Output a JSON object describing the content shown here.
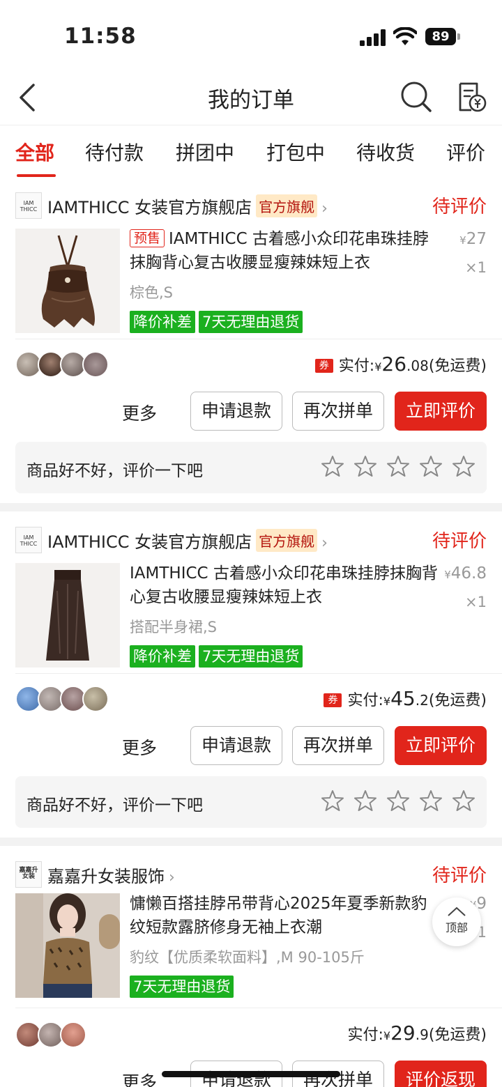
{
  "status_bar": {
    "time": "11:58",
    "battery": "89"
  },
  "nav": {
    "title": "我的订单"
  },
  "tabs": [
    {
      "label": "全部"
    },
    {
      "label": "待付款"
    },
    {
      "label": "拼团中"
    },
    {
      "label": "打包中"
    },
    {
      "label": "待收货"
    },
    {
      "label": "评价"
    }
  ],
  "orders": [
    {
      "store_name": "IAMTHICC 女装官方旗舰店",
      "store_logo_text": "IAM THICC",
      "badge": "官方旗舰",
      "status": "待评价",
      "presale": "预售",
      "title": "IAMTHICC 古着感小众印花串珠挂脖抹胸背心复古收腰显瘦辣妹短上衣",
      "spec": "棕色,S",
      "tags": [
        "降价补差",
        "7天无理由退货"
      ],
      "price_symbol": "¥",
      "unit_price": "27",
      "qty": "×1",
      "paid_label": "实付:",
      "paid_symbol": "¥",
      "paid_int": "26",
      "paid_dec": ".08",
      "shipping": "(免运费)",
      "coupon": "券",
      "more": "更多",
      "buttons": [
        "申请退款",
        "再次拼单",
        "立即评价"
      ],
      "review_prompt": "商品好不好，评价一下吧"
    },
    {
      "store_name": "IAMTHICC 女装官方旗舰店",
      "store_logo_text": "IAM THICC",
      "badge": "官方旗舰",
      "status": "待评价",
      "title": "IAMTHICC 古着感小众印花串珠挂脖抹胸背心复古收腰显瘦辣妹短上衣",
      "spec": "搭配半身裙,S",
      "tags": [
        "降价补差",
        "7天无理由退货"
      ],
      "price_symbol": "¥",
      "unit_price": "46.8",
      "qty": "×1",
      "paid_label": "实付:",
      "paid_symbol": "¥",
      "paid_int": "45",
      "paid_dec": ".2",
      "shipping": "(免运费)",
      "coupon": "券",
      "more": "更多",
      "buttons": [
        "申请退款",
        "再次拼单",
        "立即评价"
      ],
      "review_prompt": "商品好不好，评价一下吧"
    },
    {
      "store_name": "嘉嘉升女装服饰",
      "store_logo_text": "嘉嘉升 女装",
      "status": "待评价",
      "title": "慵懒百搭挂脖吊带背心2025年夏季新款豹纹短款露脐修身无袖上衣潮",
      "spec": "豹纹【优质柔软面料】,M 90-105斤",
      "tags": [
        "7天无理由退货"
      ],
      "price_symbol": "¥",
      "unit_price": "9",
      "qty": "×1",
      "paid_label": "实付:",
      "paid_symbol": "¥",
      "paid_int": "29",
      "paid_dec": ".9",
      "shipping": "(免运费)",
      "more": "更多",
      "buttons": [
        "申请退款",
        "再次拼单",
        "评价返现"
      ]
    }
  ],
  "floating": {
    "top_label": "顶部"
  },
  "colors": {
    "accent": "#e1251b",
    "tag_green": "#1bb01f",
    "badge_bg": "#ffe9c6"
  }
}
